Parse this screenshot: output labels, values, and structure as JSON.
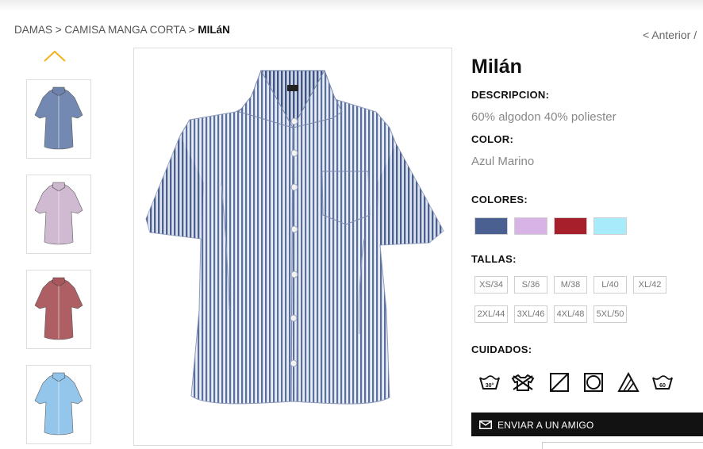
{
  "breadcrumb": {
    "item1": "DAMAS",
    "sep1": " > ",
    "item2": "CAMISA MANGA CORTA",
    "sep2": " > ",
    "current": "MILáN"
  },
  "pager": {
    "prev": "< Anterior /"
  },
  "product": {
    "title": "Milán",
    "description_label": "DESCRIPCION:",
    "description": "60% algodon 40% poliester",
    "color_label": "COLOR:",
    "color": "Azul Marino",
    "colors_label": "COLORES:",
    "swatches": [
      "#4a6091",
      "#d8b4e6",
      "#a61f2b",
      "#a8ecfb"
    ],
    "sizes_label": "TALLAS:",
    "sizes": [
      "XS/34",
      "S/36",
      "M/38",
      "L/40",
      "XL/42",
      "2XL/44",
      "3XL/46",
      "4XL/48",
      "5XL/50"
    ],
    "care_label": "CUIDADOS:",
    "care_icons": [
      "wash-30-icon",
      "no-chlorine-bleach-icon",
      "tumble-dry-icon",
      "dry-clean-icon",
      "bleach-allowed-icon",
      "wash-60-icon"
    ],
    "care_texts": [
      "30°",
      "60"
    ]
  },
  "thumbnails": [
    {
      "name": "shirt-thumbnail-navy",
      "color": "#6d83ad"
    },
    {
      "name": "shirt-thumbnail-lilac",
      "color": "#cdb7cf"
    },
    {
      "name": "shirt-thumbnail-red",
      "color": "#a9575c"
    },
    {
      "name": "shirt-thumbnail-skyblue",
      "color": "#8fc3ea"
    }
  ],
  "send": {
    "label": "ENVIAR A UN AMIGO"
  }
}
